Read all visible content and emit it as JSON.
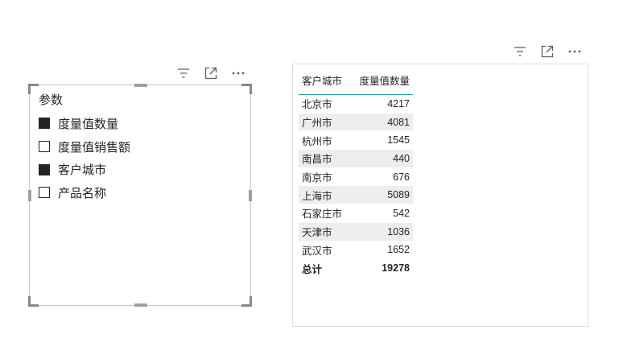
{
  "slicer": {
    "title": "参数",
    "items": [
      {
        "label": "度量值数量",
        "checked": true
      },
      {
        "label": "度量值销售额",
        "checked": false
      },
      {
        "label": "客户城市",
        "checked": true
      },
      {
        "label": "产品名称",
        "checked": false
      }
    ]
  },
  "table": {
    "headers": [
      "客户城市",
      "度量值数量"
    ],
    "rows": [
      [
        "北京市",
        "4217"
      ],
      [
        "广州市",
        "4081"
      ],
      [
        "杭州市",
        "1545"
      ],
      [
        "南昌市",
        "440"
      ],
      [
        "南京市",
        "676"
      ],
      [
        "上海市",
        "5089"
      ],
      [
        "石家庄市",
        "542"
      ],
      [
        "天津市",
        "1036"
      ],
      [
        "武汉市",
        "1652"
      ]
    ],
    "total_label": "总计",
    "total_value": "19278"
  },
  "colors": {
    "accent_line": "#2a9d9d",
    "alt_row": "#ededed",
    "text": "#252423"
  },
  "icons": [
    "filter-icon",
    "focus-mode-icon",
    "more-options-icon"
  ]
}
